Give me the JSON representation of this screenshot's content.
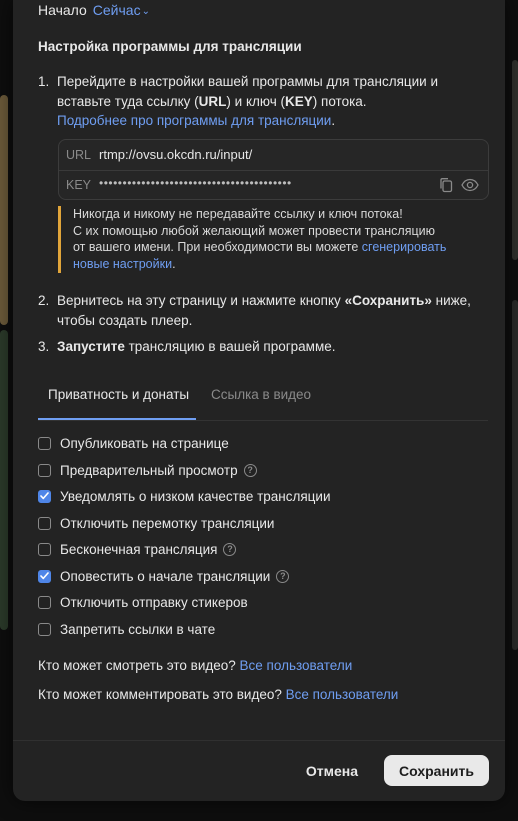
{
  "start": {
    "label": "Начало",
    "value": "Сейчас"
  },
  "section_title": "Настройка программы для трансляции",
  "steps": {
    "s1": {
      "num": "1.",
      "line1": "Перейдите в настройки вашей программы для трансляции и",
      "line2_a": "вставьте туда ссылку (",
      "line2_url": "URL",
      "line2_b": ") и ключ (",
      "line2_key": "KEY",
      "line2_c": ") потока.",
      "link": "Подробнее про программы для трансляции",
      "link_tail": "."
    },
    "s2": {
      "num": "2.",
      "a": "Вернитесь на эту страницу и нажмите кнопку ",
      "b": "«Сохранить»",
      "c": " ниже,",
      "line2": "чтобы создать плеер."
    },
    "s3": {
      "num": "3.",
      "a": "Запустите",
      "b": " трансляцию в вашей программе."
    }
  },
  "stream": {
    "url_label": "URL",
    "url_value": "rtmp://ovsu.okcdn.ru/input/",
    "key_label": "KEY",
    "key_value": "•••••••••••••••••••••••••••••••••••••••••"
  },
  "warning": {
    "line1": "Никогда и никому не передавайте ссылку и ключ потока!",
    "line2": "С их помощью любой желающий может провести трансляцию",
    "line3": "от вашего имени. При необходимости вы можете ",
    "link_a": "сгенерировать",
    "link_b": "новые настройки",
    "tail": "."
  },
  "tabs": {
    "privacy": "Приватность и донаты",
    "link_in_video": "Ссылка в видео"
  },
  "options": [
    {
      "label": "Опубликовать на странице",
      "checked": false
    },
    {
      "label": "Предварительный просмотр",
      "checked": false
    },
    {
      "label": "Уведомлять о низком качестве трансляции",
      "checked": true
    },
    {
      "label": "Отключить перемотку трансляции",
      "checked": false
    },
    {
      "label": "Бесконечная трансляция",
      "checked": false
    },
    {
      "label": "Оповестить о начале трансляции",
      "checked": true
    },
    {
      "label": "Отключить отправку стикеров",
      "checked": false
    },
    {
      "label": "Запретить ссылки в чате",
      "checked": false
    }
  ],
  "help_glyph": "?",
  "who_watch": {
    "question": "Кто может смотреть это видео?",
    "value": "Все пользователи"
  },
  "who_comment": {
    "question": "Кто может комментировать это видео?",
    "value": "Все пользователи"
  },
  "buttons": {
    "cancel": "Отмена",
    "save": "Сохранить"
  },
  "colors": {
    "accent": "#6f9ef2",
    "checkbox": "#4f86e8",
    "warning": "#e1a53a",
    "modal_bg": "#232323"
  }
}
